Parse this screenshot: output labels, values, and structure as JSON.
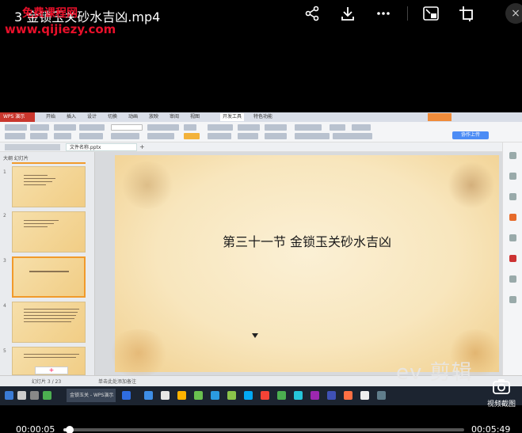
{
  "window": {
    "title": "3 金锁玉关砂水吉凶.mp4",
    "watermark_top": "免费课程网",
    "watermark_url": "www.qijiezy.com"
  },
  "toolbar": {
    "icons": [
      "share-icon",
      "download-icon",
      "more-icon",
      "pip-icon",
      "fullscreen-icon",
      "close-icon"
    ],
    "close_label": "×"
  },
  "wps": {
    "tabs": [
      "WPS 演示",
      "开始",
      "插入",
      "设计",
      "切换",
      "动画",
      "放映",
      "审阅",
      "视图",
      "开发工具",
      "特色功能"
    ],
    "document_tab": "文件名称.pptx",
    "upload_label": "协作上传",
    "sidebar_header": "大纲  幻灯片",
    "slide_numbers": [
      "1",
      "2",
      "3",
      "4",
      "5"
    ],
    "add_label": "+",
    "status_left": "幻灯片 3 / 23",
    "notes_label": "单击此处添加备注",
    "taskbar_item": "金锁玉关 - WPS演示"
  },
  "slide": {
    "title": "第三十一节  金锁玉关砂水吉凶"
  },
  "overlay": {
    "ev_logo": "ev 剪辑",
    "screenshot_label": "视频截图"
  },
  "player": {
    "current_time": "00:00:05",
    "total_time": "00:05:49",
    "progress": 0.014
  }
}
